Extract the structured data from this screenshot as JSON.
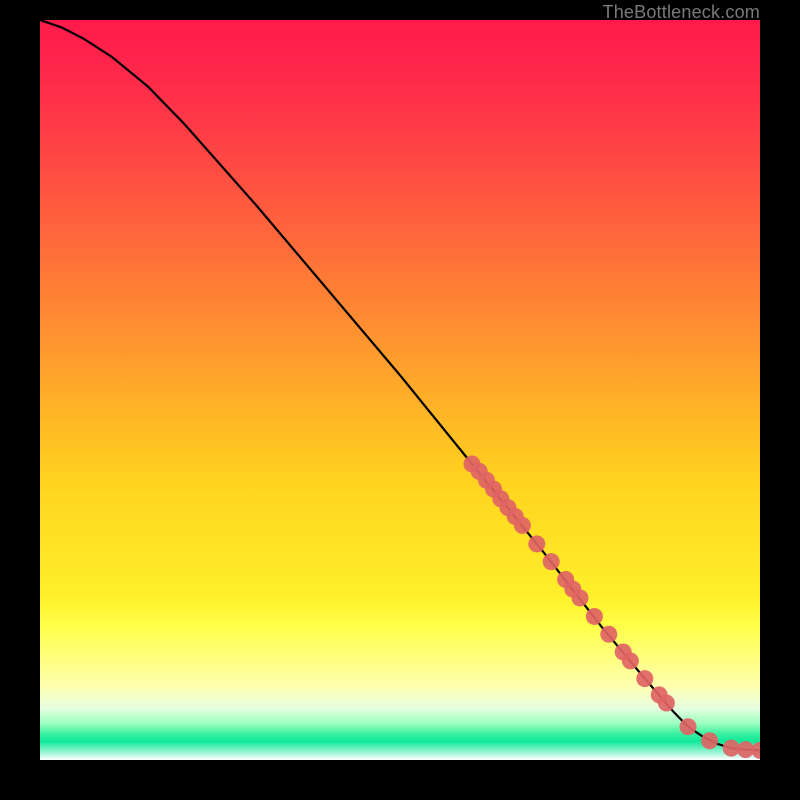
{
  "attribution": "TheBottleneck.com",
  "colors": {
    "gradient_stops": [
      {
        "offset": 0.0,
        "color": "#ff1a4b"
      },
      {
        "offset": 0.1,
        "color": "#ff2e4a"
      },
      {
        "offset": 0.25,
        "color": "#ff5a3f"
      },
      {
        "offset": 0.45,
        "color": "#ff9a2e"
      },
      {
        "offset": 0.62,
        "color": "#ffd21f"
      },
      {
        "offset": 0.78,
        "color": "#fff02a"
      },
      {
        "offset": 0.82,
        "color": "#ffff4a"
      },
      {
        "offset": 0.9,
        "color": "#ffffb0"
      },
      {
        "offset": 0.93,
        "color": "#e6ffe0"
      },
      {
        "offset": 0.95,
        "color": "#9effc0"
      },
      {
        "offset": 0.965,
        "color": "#38f0a0"
      },
      {
        "offset": 0.975,
        "color": "#10e89a"
      },
      {
        "offset": 1.0,
        "color": "#ffffff"
      }
    ],
    "curve": "#000000",
    "marker_fill": "#e06464",
    "marker_stroke": "#b94a4a"
  },
  "chart_data": {
    "type": "line",
    "title": "",
    "xlabel": "",
    "ylabel": "",
    "xlim": [
      0,
      100
    ],
    "ylim": [
      0,
      100
    ],
    "grid": false,
    "legend": false,
    "series": [
      {
        "name": "bottleneck-curve",
        "x": [
          0,
          3,
          6,
          10,
          15,
          20,
          30,
          40,
          50,
          60,
          70,
          78,
          84,
          88,
          90,
          92,
          94,
          96,
          98,
          100
        ],
        "y": [
          100,
          99,
          97.5,
          95,
          91,
          86,
          75,
          63.5,
          52,
          40,
          28,
          18,
          11,
          6.5,
          4.5,
          3.2,
          2.2,
          1.6,
          1.4,
          1.3
        ]
      }
    ],
    "markers": {
      "name": "highlighted-points",
      "x": [
        60,
        61,
        62,
        63,
        64,
        65,
        66,
        67,
        69,
        71,
        73,
        74,
        75,
        77,
        79,
        81,
        82,
        84,
        86,
        87,
        90,
        93,
        96,
        98,
        100
      ],
      "y": [
        40,
        39,
        37.8,
        36.6,
        35.3,
        34.1,
        32.9,
        31.7,
        29.2,
        26.8,
        24.4,
        23.1,
        21.9,
        19.4,
        17.0,
        14.6,
        13.4,
        11.0,
        8.8,
        7.7,
        4.5,
        2.6,
        1.6,
        1.4,
        1.3
      ]
    }
  }
}
